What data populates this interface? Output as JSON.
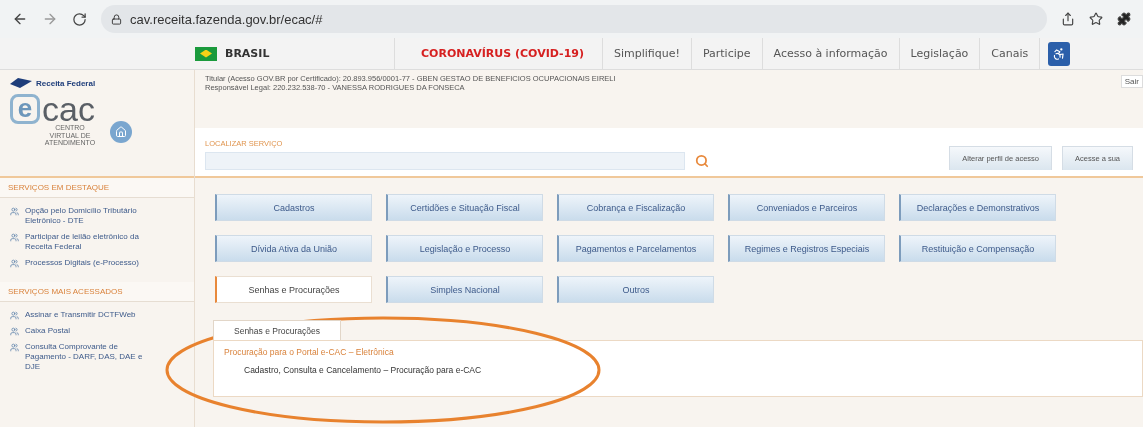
{
  "browser": {
    "url": "cav.receita.fazenda.gov.br/ecac/#"
  },
  "gov_bar": {
    "brand": "BRASIL",
    "links": [
      {
        "label": "CORONAVÍRUS (COVID-19)",
        "kind": "alert"
      },
      {
        "label": "Simplifique!",
        "kind": "normal"
      },
      {
        "label": "Participe",
        "kind": "normal"
      },
      {
        "label": "Acesso à informação",
        "kind": "normal"
      },
      {
        "label": "Legislação",
        "kind": "normal"
      },
      {
        "label": "Canais",
        "kind": "normal"
      }
    ]
  },
  "header": {
    "agency": "Receita Federal",
    "logo_mark": "e",
    "logo_text": "cac",
    "logo_subtitle": "CENTRO VIRTUAL DE ATENDIMENTO",
    "titular": "Titular (Acesso GOV.BR por Certificado): 20.893.956/0001-77 - GBEN GESTAO DE BENEFICIOS OCUPACIONAIS EIRELI",
    "responsavel": "Responsável Legal: 220.232.538-70 - VANESSA RODRIGUES DA FONSECA",
    "logout": "Sair"
  },
  "search": {
    "label": "LOCALIZAR SERVIÇO",
    "buttons": [
      "Alterar perfil de acesso",
      "Acesse a sua"
    ]
  },
  "sidebar": {
    "sections": [
      {
        "title": "SERVIÇOS EM DESTAQUE",
        "items": [
          "Opção pelo Domicílio Tributário Eletrônico - DTE",
          "Participar de leilão eletrônico da Receita Federal",
          "Processos Digitais (e-Processo)"
        ]
      },
      {
        "title": "SERVIÇOS MAIS ACESSADOS",
        "items": [
          "Assinar e Transmitir DCTFWeb",
          "Caixa Postal",
          "Consulta Comprovante de Pagamento - DARF, DAS, DAE e DJE"
        ]
      }
    ]
  },
  "categories": [
    {
      "label": "Cadastros",
      "selected": false
    },
    {
      "label": "Certidões e Situação Fiscal",
      "selected": false
    },
    {
      "label": "Cobrança e Fiscalização",
      "selected": false
    },
    {
      "label": "Conveniados e Parceiros",
      "selected": false
    },
    {
      "label": "Declarações e Demonstrativos",
      "selected": false
    },
    {
      "label": "Dívida Ativa da União",
      "selected": false
    },
    {
      "label": "Legislação e Processo",
      "selected": false
    },
    {
      "label": "Pagamentos e Parcelamentos",
      "selected": false
    },
    {
      "label": "Regimes e Registros Especiais",
      "selected": false
    },
    {
      "label": "Restituição e Compensação",
      "selected": false
    },
    {
      "label": "Senhas e Procurações",
      "selected": true
    },
    {
      "label": "Simples Nacional",
      "selected": false
    },
    {
      "label": "Outros",
      "selected": false
    }
  ],
  "subpanel": {
    "tabs": [
      {
        "label": "Senhas e Procurações",
        "selected": true
      }
    ],
    "groups": [
      {
        "title": "Procuração para o Portal e-CAC – Eletrônica",
        "items": [
          "Cadastro, Consulta e Cancelamento – Procuração para e-CAC"
        ]
      }
    ]
  }
}
